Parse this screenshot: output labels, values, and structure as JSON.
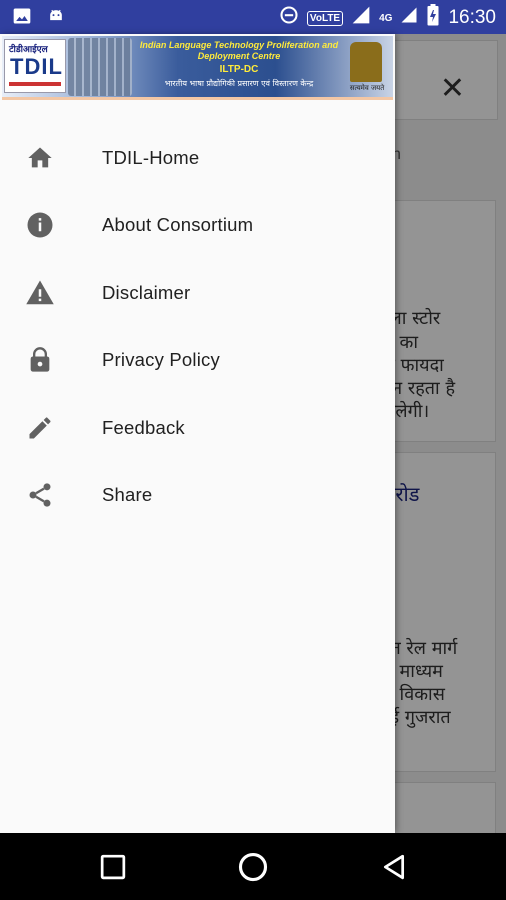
{
  "status_bar": {
    "time": "16:30",
    "volte": "VoLTE",
    "network": "4G",
    "icons": [
      "image-icon",
      "android-icon",
      "data-saver-icon",
      "signal-icon",
      "battery-icon"
    ]
  },
  "banner": {
    "logo_hindi": "टीडीआईएल",
    "logo_text": "TDIL",
    "title": "Indian Language Technology Proliferation and Deployment Centre",
    "code": "ILTP-DC",
    "hindi": "भारतीय भाषा प्रौद्योगिकी प्रसारण एवं विस्तारण केन्द्र",
    "emblem_label": "सत्यमेव जयते"
  },
  "menu": {
    "items": [
      {
        "label": "TDIL-Home",
        "icon": "home-icon"
      },
      {
        "label": "About Consortium",
        "icon": "info-icon"
      },
      {
        "label": "Disclaimer",
        "icon": "warning-icon"
      },
      {
        "label": "Privacy Policy",
        "icon": "lock-icon"
      },
      {
        "label": "Feedback",
        "icon": "pencil-icon"
      },
      {
        "label": "Share",
        "icon": "share-icon"
      }
    ]
  },
  "background": {
    "tab_fragment": "h",
    "card1_lines": [
      "हला स्टोर",
      "क का",
      "तो फायदा",
      "सून रहता है",
      "मिलेगी।"
    ],
    "card2_heading": [
      "करोड",
      ":"
    ],
    "card2_lines": [
      "युत रेल मार्ग",
      "क माध्यम",
      "क विकास",
      "बई गुजरात"
    ]
  },
  "colors": {
    "status_bar": "#303F9F",
    "drawer_bg": "#fafafa",
    "icon": "#616161",
    "text": "#212121"
  }
}
